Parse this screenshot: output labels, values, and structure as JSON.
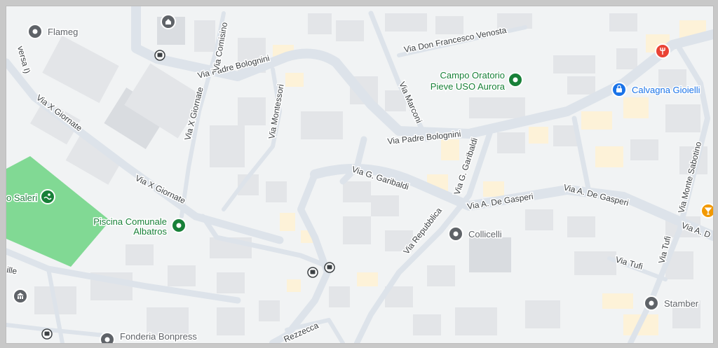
{
  "colors": {
    "background": "#f1f3f4",
    "road": "#dde3ea",
    "road_edge": "#cfd6de",
    "building": "#e3e5e8",
    "building_dark": "#d7dadf",
    "building_tan": "#fdf2d8",
    "park": "#81d994",
    "green_poi": "#188038",
    "blue_poi": "#1a73e8",
    "gray_poi": "#5f6368",
    "red_poi": "#ea4335",
    "orange_poi": "#f29900",
    "transit": "#3c4043"
  },
  "roads": {
    "padre_bolognini_west": "Via Padre Bolognini",
    "padre_bolognini_east": "Via Padre Bolognini",
    "x_giornate_west": "Via X Giornate",
    "x_giornate_center": "Via X Giornate",
    "x_giornate_north": "Via X Giornate",
    "comisino": "Via Comisino",
    "montessori": "Via Montessori",
    "don_francesco_venosta": "Via Don Francesco Venosta",
    "marconi": "Via Marconi",
    "g_garibaldi_west": "Via G. Garibaldi",
    "g_garibaldi_north": "Via G. Garibaldi",
    "de_gasperi_center": "Via A. De Gasperi",
    "de_gasperi_east": "Via A. De Gasperi",
    "de_gasperi_edge": "Via A. D",
    "repubblica": "Via Repubblica",
    "tufi_a": "Via Tufi",
    "tufi_b": "Via Tufi",
    "monte_sabotino": "Via Monte Sabotino",
    "rezzecca": "Rezzecca",
    "edge_versa": "versa I)",
    "edge_ille": "ille"
  },
  "pois": {
    "flameg": {
      "label": "Flameg",
      "icon": "place-pin-icon"
    },
    "campo_oratorio_1": {
      "label": "Campo Oratorio",
      "icon": "park-pin-icon"
    },
    "campo_oratorio_2": {
      "label": "Pieve USO Aurora"
    },
    "calvagna": {
      "label": "Calvagna Gioielli",
      "icon": "shopping-bag-pin-icon"
    },
    "saleri": {
      "label": "o Saleri",
      "icon": "swimming-pin-icon"
    },
    "piscina_1": {
      "label": "Piscina Comunale",
      "icon": "park-pin-icon"
    },
    "piscina_2": {
      "label": "Albatros"
    },
    "collicelli": {
      "label": "Collicelli",
      "icon": "place-pin-icon"
    },
    "stamber": {
      "label": "Stamber",
      "icon": "place-pin-icon"
    },
    "fonderia": {
      "label": "Fonderia Bonpress",
      "icon": "place-pin-icon"
    },
    "shelter": {
      "icon": "church-pin-icon"
    },
    "museum": {
      "icon": "museum-pin-icon"
    },
    "restaurant": {
      "icon": "restaurant-pin-icon"
    },
    "bar": {
      "icon": "bar-pin-icon"
    }
  },
  "transit": {
    "icon": "bus-stop-icon"
  }
}
